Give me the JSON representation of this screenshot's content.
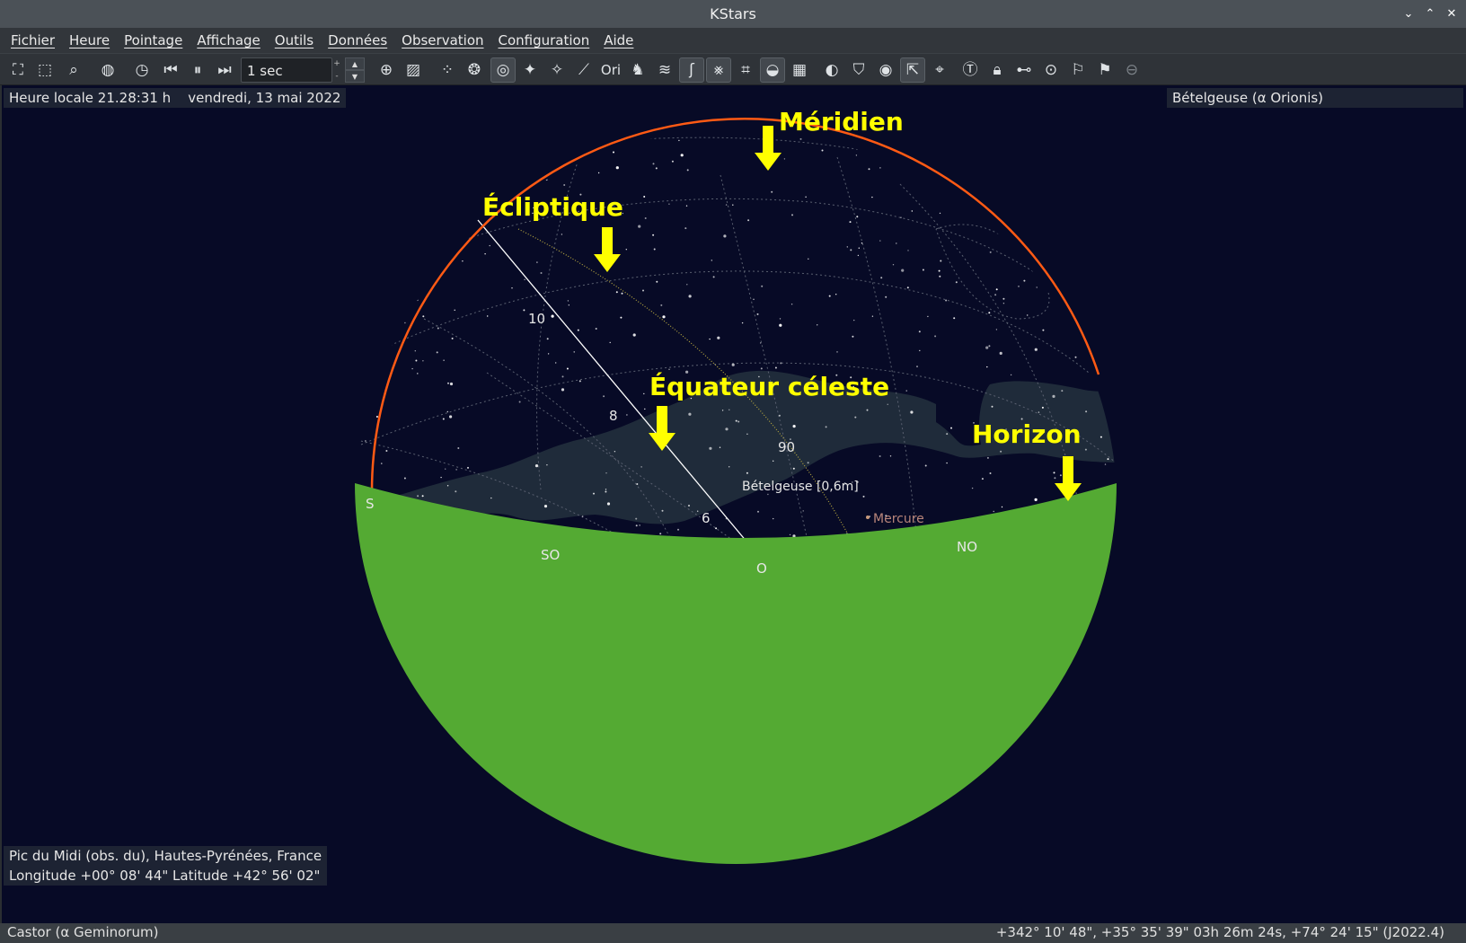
{
  "window": {
    "title": "KStars"
  },
  "menu": [
    "Fichier",
    "Heure",
    "Pointage",
    "Affichage",
    "Outils",
    "Données",
    "Observation",
    "Configuration",
    "Aide"
  ],
  "toolbar": {
    "time_step": "1 sec"
  },
  "overlay": {
    "time": "Heure locale 21.28:31 h",
    "date": "vendredi, 13 mai 2022",
    "focus_object": "Bételgeuse (α Orionis)",
    "location": "Pic du Midi (obs. du), Hautes-Pyrénées, France",
    "coordinates": "Longitude +00° 08' 44\" Latitude +42° 56' 02\""
  },
  "sky": {
    "cardinal": {
      "s": "S",
      "sw": "SO",
      "w": "O",
      "nw": "NO"
    },
    "equator_ticks": {
      "t10": "10",
      "t8": "8",
      "t6": "6"
    },
    "ecliptic_tick": "90",
    "star_label": "Bételgeuse [0,6m]",
    "planet_label": "Mercure",
    "annotations": {
      "meridian": "Méridien",
      "ecliptic": "Écliptique",
      "equator": "Équateur céleste",
      "horizon": "Horizon"
    },
    "colors": {
      "background": "#070a26",
      "ground": "#54aa33",
      "meridian": "#ff5a14",
      "annotation": "#ffff00",
      "milky_way": "#1f2b3a"
    }
  },
  "status": {
    "hover_object": "Castor (α Geminorum)",
    "cursor_coords": "+342° 10' 48\", +35° 35' 39\"  03h 26m 24s, +74° 24' 15\" (J2022.4)"
  }
}
